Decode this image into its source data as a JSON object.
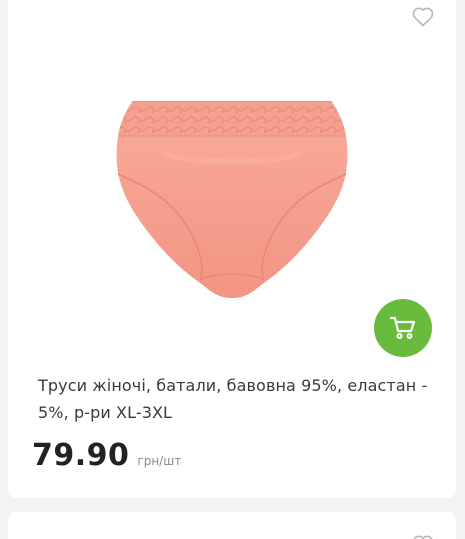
{
  "product": {
    "title": "Труси жіночі, батали, бавовна 95%, еластан - 5%, р-ри XL-3XL",
    "price": "79.90",
    "unit": "грн/шт",
    "image_color": "#f7a08f",
    "accent_color": "#69bb3e"
  },
  "icons": {
    "favorite": "heart-outline-icon",
    "cart": "shopping-cart-icon"
  }
}
